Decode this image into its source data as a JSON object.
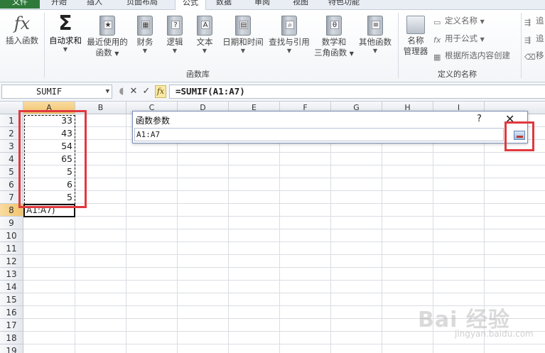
{
  "tabs": {
    "file": "文件",
    "items": [
      "开始",
      "插入",
      "页面布局",
      "公式",
      "数据",
      "审阅",
      "视图",
      "特色功能"
    ],
    "active_index": 3
  },
  "ribbon": {
    "insert_function": "插入函数",
    "autosum": "自动求和",
    "recent_line1": "最近使用的",
    "recent_line2": "函数",
    "finance": "财务",
    "logic": "逻辑",
    "text": "文本",
    "datetime": "日期和时间",
    "lookup": "查找与引用",
    "math_line1": "数学和",
    "math_line2": "三角函数",
    "other": "其他函数",
    "group_library": "函数库",
    "name_manager_line1": "名称",
    "name_manager_line2": "管理器",
    "define_name": "定义名称",
    "use_in_formula": "用于公式",
    "create_from_selection": "根据所选内容创建",
    "group_names": "定义的名称",
    "trace_1": "追",
    "trace_2": "追",
    "trace_3": "移"
  },
  "formula_bar": {
    "name_box": "SUMIF",
    "fx": "fx",
    "formula": "=SUMIF(A1:A7)"
  },
  "grid": {
    "columns": [
      "A",
      "B",
      "C",
      "D",
      "E",
      "F",
      "G",
      "H",
      "I"
    ],
    "rows": [
      "1",
      "2",
      "3",
      "4",
      "5",
      "6",
      "7",
      "8",
      "9",
      "10",
      "11",
      "12",
      "13",
      "14",
      "15",
      "16",
      "17",
      "18",
      "19"
    ],
    "values": [
      "33",
      "43",
      "54",
      "65",
      "5",
      "6",
      "5"
    ],
    "active_cell_text": "A1:A7)"
  },
  "dialog": {
    "title": "函数参数",
    "help": "?",
    "close": "✕",
    "input_value": "A1:A7"
  },
  "watermark": {
    "main": "Bai 经验",
    "sub": "jingyan.baidu.com"
  }
}
